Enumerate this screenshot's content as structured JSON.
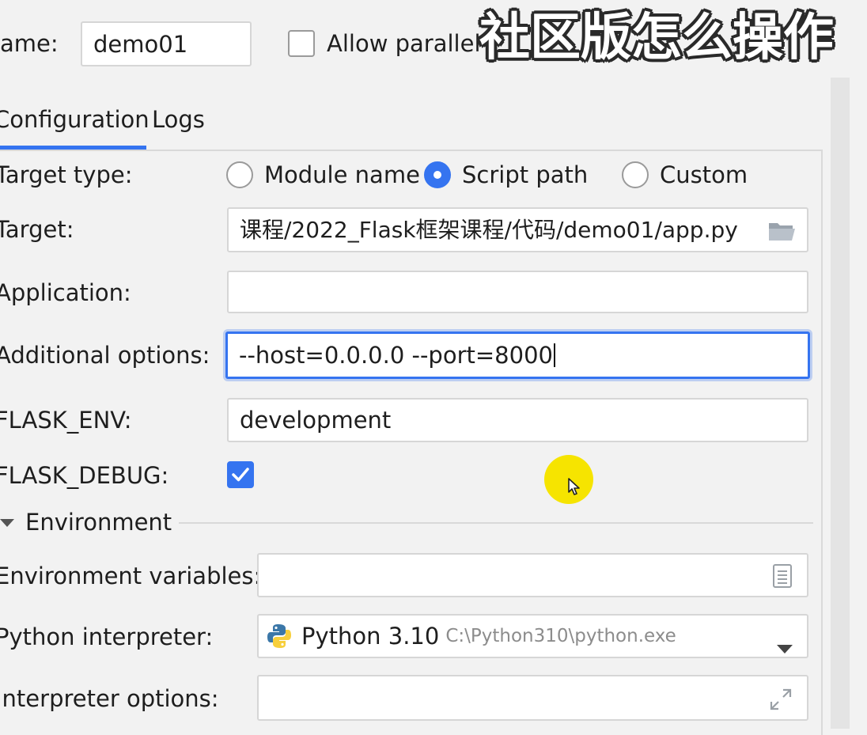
{
  "header": {
    "name_label": "ame:",
    "name_value": "demo01",
    "allow_parallel_label": "Allow parallel"
  },
  "overlay": {
    "caption": "社区版怎么操作"
  },
  "tabs": [
    {
      "label": "Configuration",
      "active": true
    },
    {
      "label": "Logs",
      "active": false
    }
  ],
  "form": {
    "target_type_label": "Target type:",
    "target_type_options": [
      {
        "label": "Module name",
        "selected": false
      },
      {
        "label": "Script path",
        "selected": true
      },
      {
        "label": "Custom",
        "selected": false
      }
    ],
    "target_label": "Target:",
    "target_value": "课程/2022_Flask框架课程/代码/demo01/app.py",
    "application_label": "Application:",
    "application_value": "",
    "additional_options_label": "Additional options:",
    "additional_options_value": "--host=0.0.0.0 --port=8000",
    "flask_env_label": "FLASK_ENV:",
    "flask_env_value": "development",
    "flask_debug_label": "FLASK_DEBUG:",
    "flask_debug_checked": true,
    "environment_section_label": "Environment",
    "env_vars_label": "Environment variables:",
    "env_vars_value": "",
    "python_interpreter_label": "Python interpreter:",
    "python_interpreter_name": "Python 3.10",
    "python_interpreter_path": "C:\\Python310\\python.exe",
    "interpreter_options_label": "Interpreter options:",
    "interpreter_options_value": ""
  },
  "colors": {
    "accent": "#3574f0",
    "background": "#f2f2f2",
    "cursor_highlight": "#f6e400"
  },
  "icons": [
    "folder-icon",
    "document-icon",
    "python-logo-icon",
    "chevron-down-icon",
    "expand-icon",
    "triangle-down-icon",
    "checkmark-icon",
    "mouse-cursor-icon"
  ]
}
